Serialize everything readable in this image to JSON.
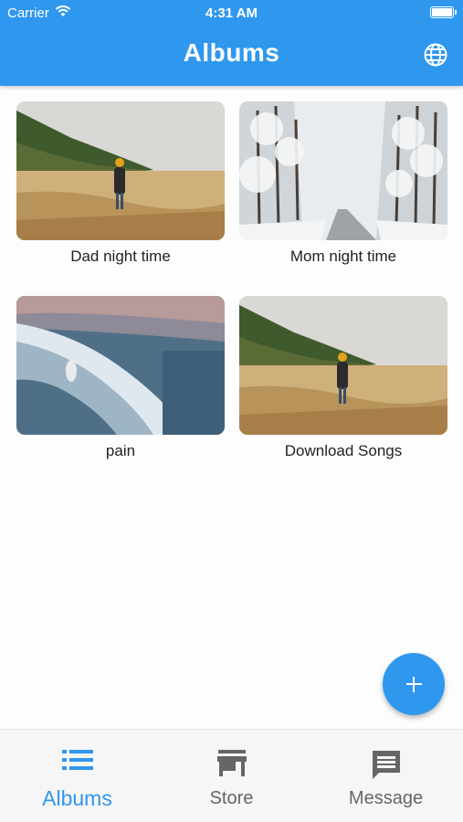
{
  "status": {
    "carrier": "Carrier",
    "time": "4:31 AM"
  },
  "header": {
    "title": "Albums",
    "action_icon": "globe-icon"
  },
  "albums": [
    {
      "title": "Dad night time",
      "image": "person-in-wheat-field"
    },
    {
      "title": "Mom night time",
      "image": "snowy-forest-road"
    },
    {
      "title": "pain",
      "image": "ocean-wave-surfer"
    },
    {
      "title": "Download Songs",
      "image": "person-in-wheat-field"
    }
  ],
  "fab": {
    "icon": "plus-icon"
  },
  "nav": [
    {
      "label": "Albums",
      "icon": "list-icon",
      "active": true
    },
    {
      "label": "Store",
      "icon": "store-icon",
      "active": false
    },
    {
      "label": "Message",
      "icon": "message-icon",
      "active": false
    }
  ],
  "colors": {
    "primary": "#2f97ee",
    "inactive": "#666666"
  }
}
